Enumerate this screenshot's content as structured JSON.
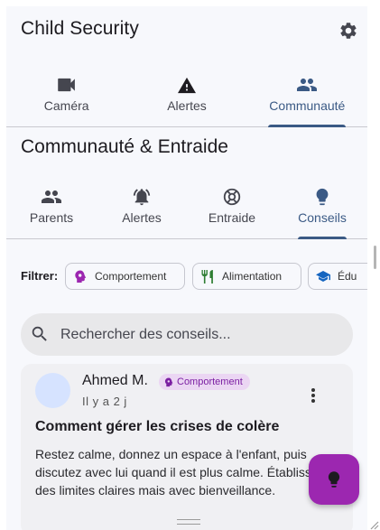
{
  "app": {
    "title": "Child Security"
  },
  "top_tabs": [
    {
      "label": "Caméra",
      "icon": "videocam-icon",
      "active": false
    },
    {
      "label": "Alertes",
      "icon": "warning-icon",
      "active": false
    },
    {
      "label": "Communauté",
      "icon": "people-icon",
      "active": true
    }
  ],
  "section": {
    "title": "Communauté & Entraide"
  },
  "sub_tabs": [
    {
      "label": "Parents",
      "icon": "people-icon",
      "active": false
    },
    {
      "label": "Alertes",
      "icon": "alarm-bell-icon",
      "active": false
    },
    {
      "label": "Entraide",
      "icon": "lifebuoy-icon",
      "active": false
    },
    {
      "label": "Conseils",
      "icon": "lightbulb-icon",
      "active": true
    }
  ],
  "filter": {
    "label": "Filtrer:",
    "chips": [
      {
        "label": "Comportement",
        "icon": "psychology-icon",
        "color": "#9c27b0"
      },
      {
        "label": "Alimentation",
        "icon": "restaurant-icon",
        "color": "#2e7d32"
      },
      {
        "label": "Édu",
        "icon": "school-icon",
        "color": "#1565c0"
      }
    ]
  },
  "search": {
    "placeholder": "Rechercher des conseils..."
  },
  "post": {
    "author": "Ahmed M.",
    "badge": "Comportement",
    "time": "Il y a 2 j",
    "title": "Comment gérer les crises de colère",
    "body": "Restez calme, donnez un espace à l'enfant, puis discutez avec lui quand il est plus calme. Établissez des limites claires mais avec bienveillance."
  },
  "colors": {
    "accent": "#3b5a85",
    "fab": "#9c27b0",
    "badge_bg": "#ebd6f3",
    "badge_text": "#7b1fa2",
    "avatar": "#d6e3ff"
  },
  "fab": {
    "icon": "lightbulb-icon"
  }
}
